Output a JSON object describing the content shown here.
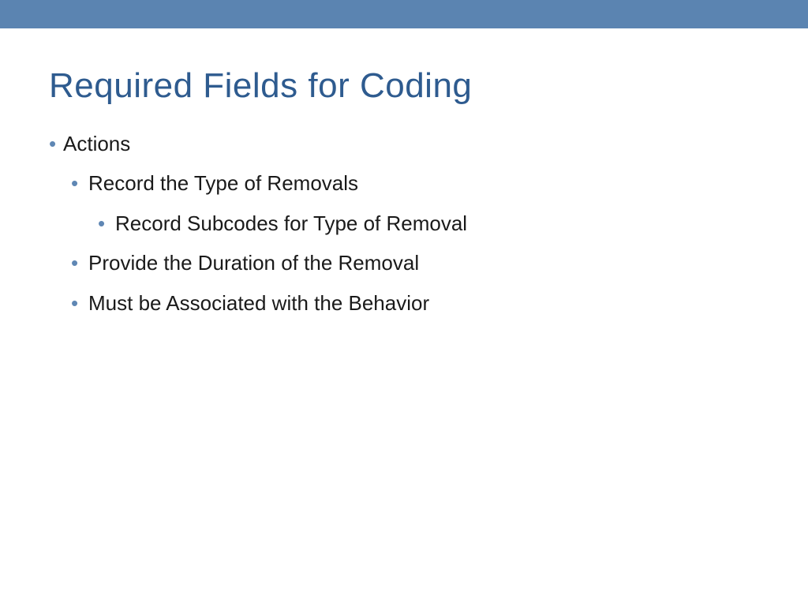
{
  "slide": {
    "title": "Required Fields for Coding",
    "bullets": {
      "l1_0": "Actions",
      "l2_0": "Record the Type of Removals",
      "l3_0": "Record Subcodes for Type of Removal",
      "l2_1": "Provide the Duration of the Removal",
      "l2_2": "Must be Associated with the Behavior"
    }
  },
  "colors": {
    "accent": "#5b84b1",
    "title": "#2e5b8f",
    "bullet": "#5f87b4"
  }
}
